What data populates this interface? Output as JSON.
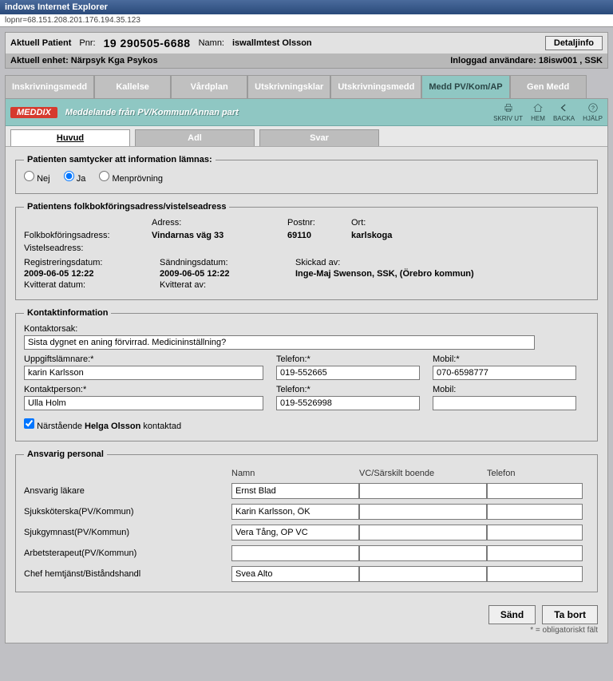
{
  "window": {
    "title": "indows Internet Explorer",
    "url": "lopnr=68.151.208.201.176.194.35.123"
  },
  "patient": {
    "label": "Aktuell Patient",
    "pnr_label": "Pnr:",
    "pnr": "19 290505-6688",
    "name_label": "Namn:",
    "name": "iswallmtest Olsson",
    "detalj": "Detaljinfo",
    "unit_label": "Aktuell enhet:",
    "unit": "Närpsyk Kga Psykos",
    "login_label": "Inloggad användare:",
    "login": "18isw001 , SSK"
  },
  "maintabs": {
    "t0": "Inskrivningsmedd",
    "t1": "Kallelse",
    "t2": "Vårdplan",
    "t3": "Utskrivningsklar",
    "t4": "Utskrivningsmedd",
    "t5": "Medd PV/Kom/AP",
    "t6": "Gen Medd"
  },
  "bluebar": {
    "logo": "MEDDIX",
    "title": "Meddelande från PV/Kommun/Annan part",
    "print": "SKRIV UT",
    "home": "HEM",
    "back": "BACKA",
    "help": "HJÄLP"
  },
  "subtabs": {
    "huvud": "Huvud",
    "adl": "Adl",
    "svar": "Svar"
  },
  "consent": {
    "legend": "Patienten samtycker att information lämnas:",
    "nej": "Nej",
    "ja": "Ja",
    "men": "Menprövning",
    "selected": "ja"
  },
  "address": {
    "legend": "Patientens folkbokföringsadress/vistelseadress",
    "h_adress": "Adress:",
    "h_postnr": "Postnr:",
    "h_ort": "Ort:",
    "folk_label": "Folkbokföringsadress:",
    "folk_adress": "Vindarnas väg 33",
    "folk_postnr": "69110",
    "folk_ort": "karlskoga",
    "vist_label": "Vistelseadress:"
  },
  "meta": {
    "reg_l": "Registreringsdatum:",
    "reg_v": "2009-06-05 12:22",
    "snd_l": "Sändningsdatum:",
    "snd_v": "2009-06-05 12:22",
    "skk_l": "Skickad av:",
    "skk_v": "Inge-Maj Swenson, SSK, (Örebro kommun)",
    "kvd_l": "Kvitterat datum:",
    "kva_l": "Kvitterat av:"
  },
  "kontakt": {
    "legend": "Kontaktinformation",
    "orsak_l": "Kontaktorsak:",
    "orsak_v": "Sista dygnet en aning förvirrad. Medicininställning?",
    "upp_l": "Uppgiftslämnare:*",
    "upp_v": "karin Karlsson",
    "tel1_l": "Telefon:*",
    "tel1_v": "019-552665",
    "mob1_l": "Mobil:*",
    "mob1_v": "070-6598777",
    "kp_l": "Kontaktperson:*",
    "kp_v": "Ulla Holm",
    "tel2_l": "Telefon:*",
    "tel2_v": "019-5526998",
    "mob2_l": "Mobil:",
    "mob2_v": "",
    "chk_pre": "Närstående",
    "chk_name": "Helga Olsson",
    "chk_post": "kontaktad"
  },
  "personal": {
    "legend": "Ansvarig personal",
    "h_namn": "Namn",
    "h_vc": "VC/Särskilt boende",
    "h_tel": "Telefon",
    "rows": {
      "r0": {
        "label": "Ansvarig läkare",
        "name": "Ernst Blad",
        "vc": "",
        "tel": ""
      },
      "r1": {
        "label": "Sjuksköterska(PV/Kommun)",
        "name": "Karin Karlsson, ÖK",
        "vc": "",
        "tel": ""
      },
      "r2": {
        "label": "Sjukgymnast(PV/Kommun)",
        "name": "Vera Tång, OP VC",
        "vc": "",
        "tel": ""
      },
      "r3": {
        "label": "Arbetsterapeut(PV/Kommun)",
        "name": "",
        "vc": "",
        "tel": ""
      },
      "r4": {
        "label": "Chef hemtjänst/Biståndshandl",
        "name": "Svea Alto",
        "vc": "",
        "tel": ""
      }
    }
  },
  "actions": {
    "send": "Sänd",
    "delete": "Ta bort"
  },
  "footnote": "* = obligatoriskt fält"
}
